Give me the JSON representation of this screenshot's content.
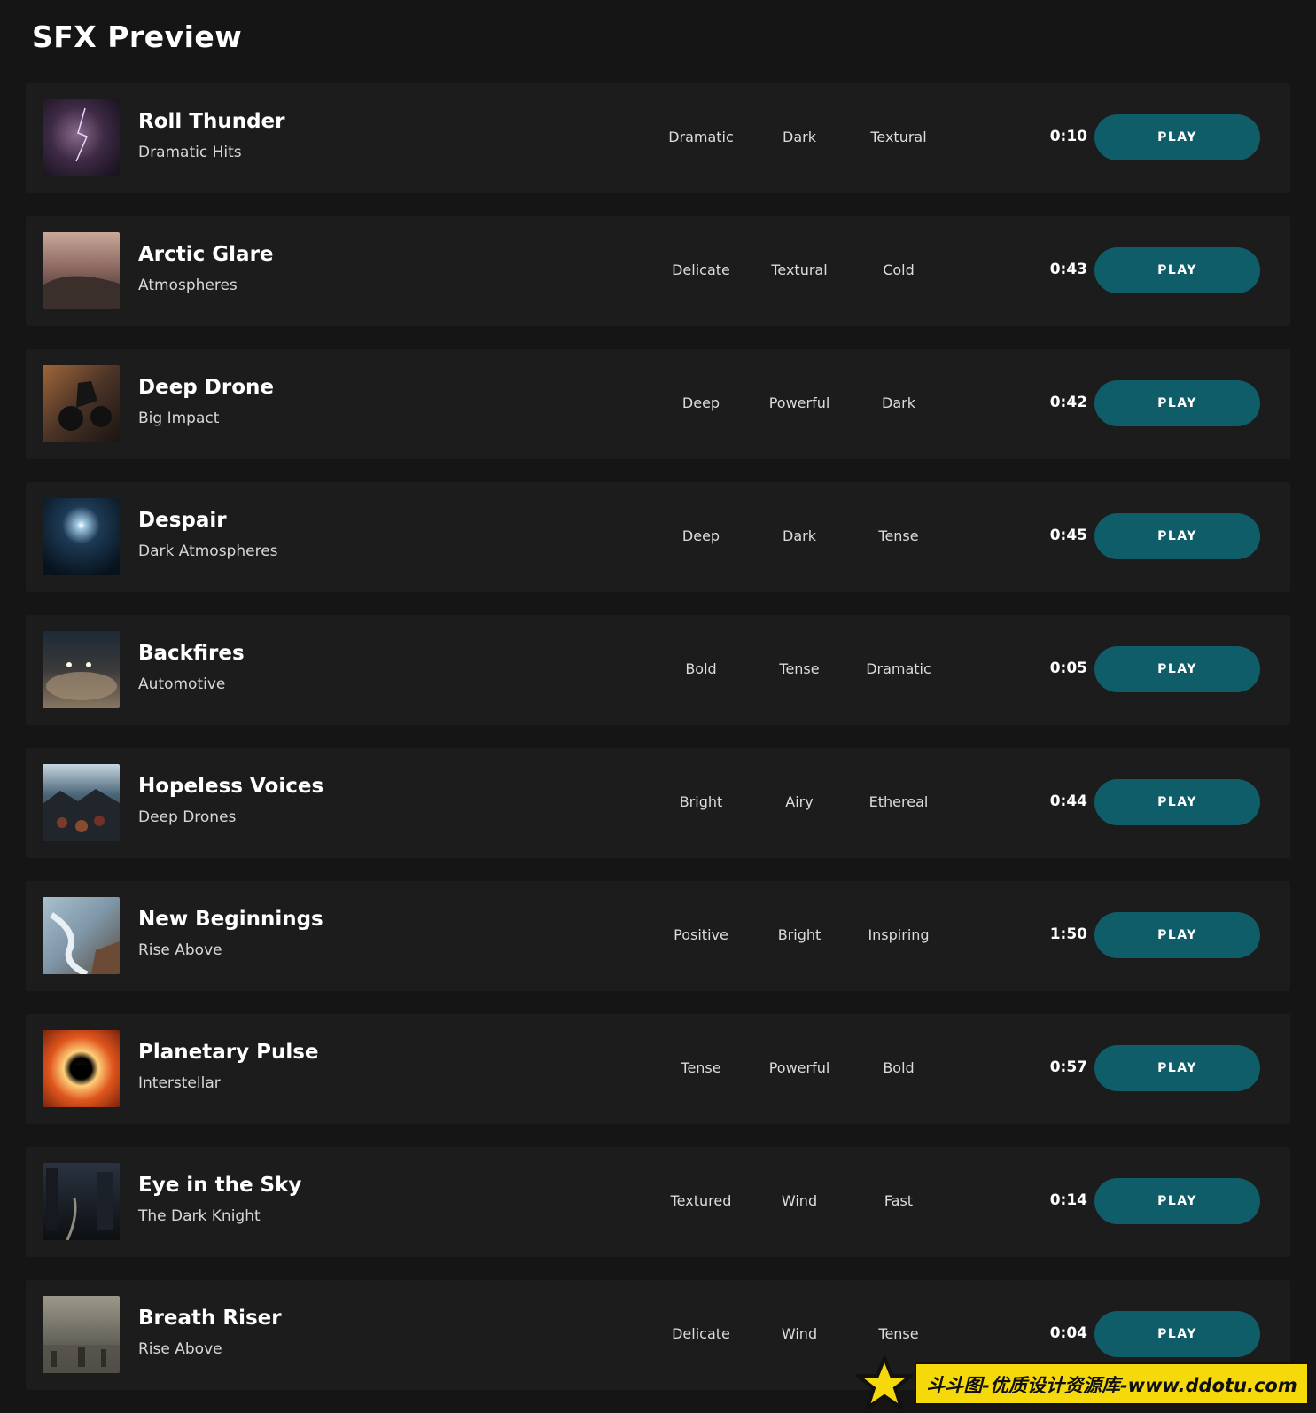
{
  "page": {
    "title": "SFX Preview"
  },
  "play_label": "PLAY",
  "tracks": [
    {
      "title": "Roll Thunder",
      "subtitle": "Dramatic Hits",
      "tags": [
        "Dramatic",
        "Dark",
        "Textural"
      ],
      "duration": "0:10"
    },
    {
      "title": "Arctic Glare",
      "subtitle": "Atmospheres",
      "tags": [
        "Delicate",
        "Textural",
        "Cold"
      ],
      "duration": "0:43"
    },
    {
      "title": "Deep Drone",
      "subtitle": "Big Impact",
      "tags": [
        "Deep",
        "Powerful",
        "Dark"
      ],
      "duration": "0:42"
    },
    {
      "title": "Despair",
      "subtitle": "Dark Atmospheres",
      "tags": [
        "Deep",
        "Dark",
        "Tense"
      ],
      "duration": "0:45"
    },
    {
      "title": "Backfires",
      "subtitle": "Automotive",
      "tags": [
        "Bold",
        "Tense",
        "Dramatic"
      ],
      "duration": "0:05"
    },
    {
      "title": "Hopeless Voices",
      "subtitle": "Deep Drones",
      "tags": [
        "Bright",
        "Airy",
        "Ethereal"
      ],
      "duration": "0:44"
    },
    {
      "title": "New Beginnings",
      "subtitle": "Rise Above",
      "tags": [
        "Positive",
        "Bright",
        "Inspiring"
      ],
      "duration": "1:50"
    },
    {
      "title": "Planetary Pulse",
      "subtitle": "Interstellar",
      "tags": [
        "Tense",
        "Powerful",
        "Bold"
      ],
      "duration": "0:57"
    },
    {
      "title": "Eye in the Sky",
      "subtitle": "The Dark Knight",
      "tags": [
        "Textured",
        "Wind",
        "Fast"
      ],
      "duration": "0:14"
    },
    {
      "title": "Breath Riser",
      "subtitle": "Rise Above",
      "tags": [
        "Delicate",
        "Wind",
        "Tense"
      ],
      "duration": "0:04"
    }
  ],
  "watermark": {
    "text": "斗斗图-优质设计资源库-www.ddotu.com"
  },
  "colors": {
    "background": "#151515",
    "row": "#1c1c1c",
    "button": "#0e5d68"
  }
}
